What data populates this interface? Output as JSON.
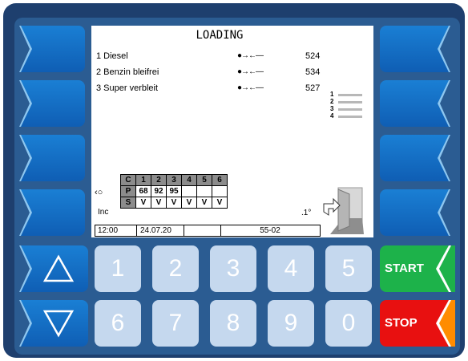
{
  "screen": {
    "title": "LOADING",
    "products": [
      {
        "label": "1 Diesel",
        "valve": "●→←—",
        "value": "524"
      },
      {
        "label": "2 Benzin bleifrei",
        "valve": "●→←—",
        "value": "534"
      },
      {
        "label": "3 Super verbleit",
        "valve": "●→←—",
        "value": "527"
      }
    ],
    "chambers": [
      "1",
      "2",
      "3",
      "4"
    ],
    "grid": {
      "row_labels": [
        "C",
        "P",
        "S"
      ],
      "columns": [
        "1",
        "2",
        "3",
        "4",
        "5",
        "6"
      ],
      "p_values": [
        "68",
        "92",
        "95",
        "",
        "",
        ""
      ],
      "s_values": [
        "V",
        "V",
        "V",
        "V",
        "V",
        "V"
      ]
    },
    "side_left_icon": "‹○",
    "partial_text_left": "Inc",
    "partial_text_right": ".1°",
    "status": {
      "time": "12:00",
      "date": "24.07.20",
      "empty": "",
      "code": "55-02"
    },
    "door_icon": "door-open-icon"
  },
  "keypad": {
    "row1": [
      "1",
      "2",
      "3",
      "4",
      "5"
    ],
    "row2": [
      "6",
      "7",
      "8",
      "9",
      "0"
    ]
  },
  "buttons": {
    "up_icon": "triangle-up-icon",
    "down_icon": "triangle-down-icon",
    "start_label": "START",
    "stop_label": "STOP"
  },
  "colors": {
    "frame": "#1e3f6e",
    "panel": "#2b5c92",
    "softkey": "#1268c4",
    "start": "#1db24a",
    "stop": "#e81010",
    "stop_notch": "#ff8c00",
    "key": "#c5d8ee"
  }
}
